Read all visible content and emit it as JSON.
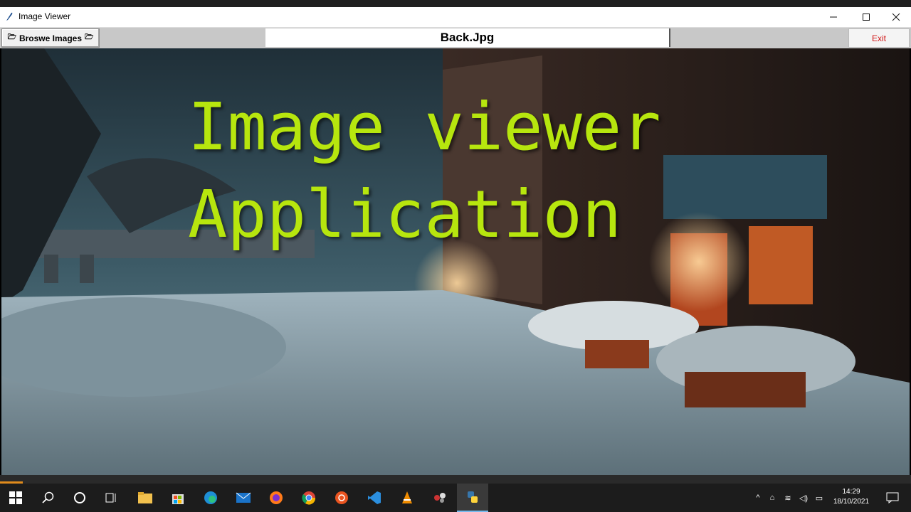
{
  "window": {
    "title": "Image Viewer"
  },
  "toolbar": {
    "browse_label": "Broswe Images",
    "filename": "Back.Jpg",
    "exit_label": "Exit"
  },
  "overlay": {
    "line1": "Image viewer",
    "line2": "Application"
  },
  "taskbar": {
    "time": "14:29",
    "date": "18/10/2021"
  },
  "colors": {
    "overlay_text": "#b7e60e",
    "exit_text": "#d11818",
    "taskbar_bg": "#1c1c1c"
  }
}
